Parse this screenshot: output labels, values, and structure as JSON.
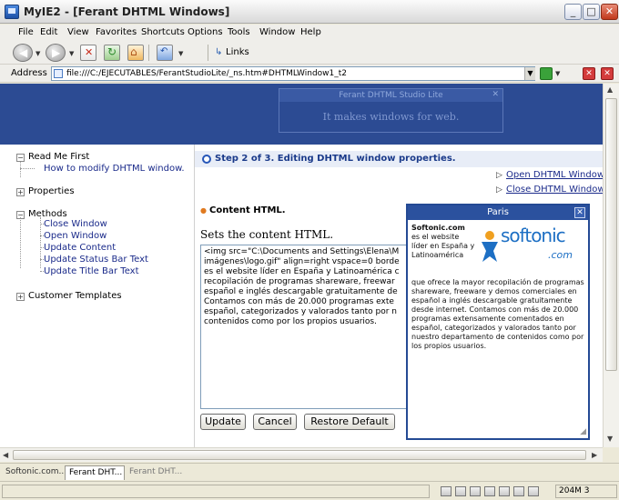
{
  "window": {
    "title": "MyIE2 - [Ferant DHTML Windows]",
    "minimize": "_",
    "maximize": "□",
    "close": "✕"
  },
  "menu": [
    "File",
    "Edit",
    "View",
    "Favorites",
    "Shortcuts",
    "Options",
    "Tools",
    "Window",
    "Help"
  ],
  "toolbar": {
    "links_label": "Links"
  },
  "address": {
    "label": "Address",
    "value": "file:///C:/EJECUTABLES/FerantStudioLite/_ns.htm#DHTMLWindow1_t2"
  },
  "banner": {
    "studio_title": "Ferant DHTML Studio Lite",
    "tagline": "It makes windows for web."
  },
  "tree": {
    "readme": "Read Me First",
    "readme_link": "How to modify DHTML window.",
    "properties": "Properties",
    "methods": "Methods",
    "method_links": [
      "Close Window",
      "Open Window",
      "Update Content",
      "Update Status Bar Text",
      "Update Title Bar Text"
    ],
    "customer_templates": "Customer Templates",
    "expand_glyph": "+",
    "collapse_glyph": "−"
  },
  "content": {
    "step": "Step 2 of 3. Editing DHTML window properties.",
    "open_link": "Open DHTML Window",
    "close_link": "Close DHTML Window",
    "link_arrow": "▷",
    "section_title": "Content HTML.",
    "set_label": "Sets the content HTML.",
    "code": "<img src=\"C:\\Documents and Settings\\Elena\\M\nimágenes\\logo.gif\" align=right vspace=0 borde\nes el website líder en España y Latinoamérica c\nrecopilación de programas shareware, freewar\nespañol e inglés descargable gratuitamente de\nContamos con más de 20.000 programas exte\nespañol, categorizados y valorados tanto por n\ncontenidos como por los propios usuarios.",
    "buttons": {
      "update": "Update",
      "cancel": "Cancel",
      "restore": "Restore Default"
    }
  },
  "popup": {
    "title": "Paris",
    "close": "✕",
    "brand": "Softonic.com",
    "side_text": " es el website líder en España y Latinoamérica",
    "body_text": "que ofrece la mayor recopilación de programas shareware, freeware y demos comerciales en español a inglés descargable gratuitamente desde internet. Contamos con más de 20.000 programas extensamente comentados en español, categorizados y valorados tanto por nuestro departamento de contenidos como por los propios usuarios.",
    "logo_text": "softonic",
    "logo_sub": ".com"
  },
  "tabs": [
    "Softonic.com...",
    "Ferant DHT...",
    "Ferant DHT..."
  ],
  "status": {
    "memory": "204M 3"
  },
  "colors": {
    "banner": "#2c4b93",
    "popup_border": "#244a94",
    "link": "#1a2a8a",
    "logo": "#1d6fc4"
  }
}
